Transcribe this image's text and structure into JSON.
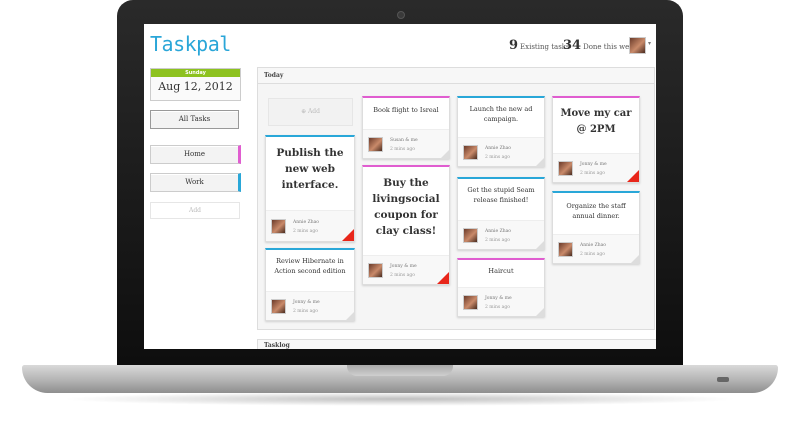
{
  "app": {
    "logo": "Taskpal"
  },
  "header": {
    "existing_count": "9",
    "existing_label": "Existing tasks",
    "done_count": "34",
    "done_label": "Done this week",
    "caret": "▾"
  },
  "sidebar": {
    "day": "Sunday",
    "date": "Aug 12, 2012",
    "all_tasks": "All Tasks",
    "lists": [
      {
        "label": "Home",
        "color": "#e05dd0"
      },
      {
        "label": "Work",
        "color": "#29a7d8"
      }
    ],
    "add": "Add"
  },
  "today": {
    "title": "Today",
    "add": "Add",
    "cards": [
      {
        "title": "Publish the new web interface.",
        "who": "Annie Zhao",
        "when": "2 mins ago",
        "color": "#29a7d8",
        "flag": true
      },
      {
        "title": "Review Hibernate in Action second edition",
        "who": "Jonny & me",
        "when": "2 mins ago",
        "color": "#29a7d8",
        "flag": false
      },
      {
        "title": "Book flight to Isreal",
        "who": "Susan & me",
        "when": "2 mins ago",
        "color": "#e05dd0",
        "flag": false
      },
      {
        "title": "Buy the livingsocial coupon for clay class!",
        "who": "Jonny & me",
        "when": "2 mins ago",
        "color": "#e05dd0",
        "flag": true
      },
      {
        "title": "Launch the new ad campaign.",
        "who": "Annie Zhao",
        "when": "2 mins ago",
        "color": "#29a7d8",
        "flag": false
      },
      {
        "title": "Get the stupid Seam release finished!",
        "who": "Annie Zhao",
        "when": "2 mins ago",
        "color": "#29a7d8",
        "flag": false
      },
      {
        "title": "Haircut",
        "who": "Jonny & me",
        "when": "2 mins ago",
        "color": "#e05dd0",
        "flag": false
      },
      {
        "title": "Move my car @ 2PM",
        "who": "Jonny & me",
        "when": "2 mins ago",
        "color": "#e05dd0",
        "flag": true
      },
      {
        "title": "Organize the staff annual dinner.",
        "who": "Annie Zhao",
        "when": "2 mins ago",
        "color": "#29a7d8",
        "flag": false
      }
    ]
  },
  "tasklog": {
    "title": "Tasklog"
  },
  "colors": {
    "accent": "#29a7d8",
    "home": "#e05dd0",
    "date_bar": "#8dc21f",
    "flag": "#e8261a"
  }
}
